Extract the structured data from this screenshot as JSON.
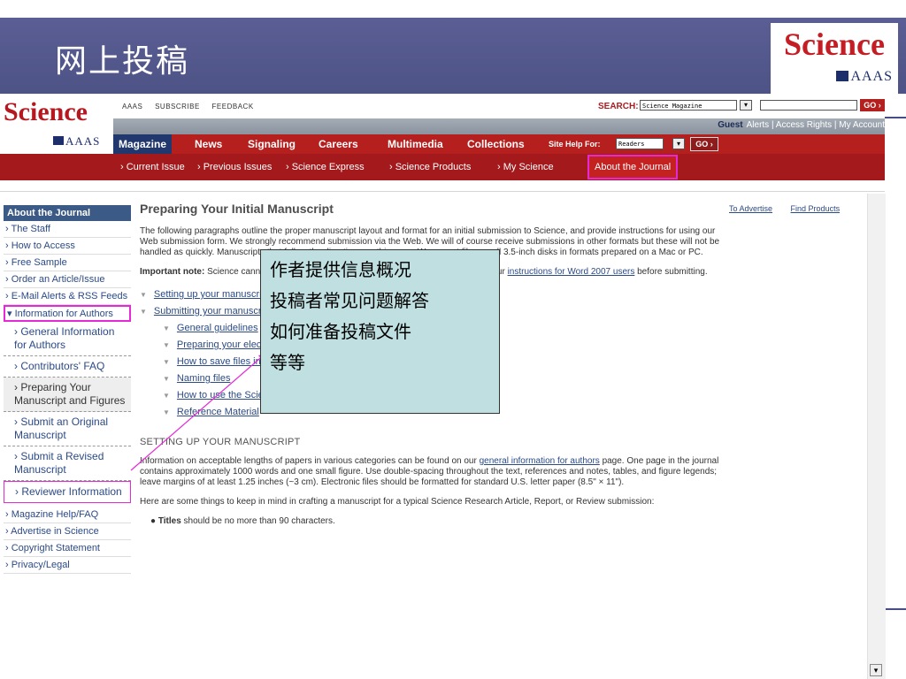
{
  "slide": {
    "title": "网上投稿",
    "logo_text": "Science",
    "logo_sub": "AAAS"
  },
  "site": {
    "logo": "Science",
    "logo_sub": "AAAS",
    "util_links": [
      "AAAS",
      "SUBSCRIBE",
      "FEEDBACK"
    ],
    "search_label": "SEARCH:",
    "search_select": "Science Magazine",
    "go": "GO ›",
    "guest": "Guest",
    "account_links": "Alerts | Access Rights | My Account",
    "nav_tabs": [
      "Magazine",
      "News",
      "Signaling",
      "Careers",
      "Multimedia",
      "Collections"
    ],
    "help_label": "Site Help For:",
    "help_select": "Readers",
    "help_go": "GO ›",
    "subnav": [
      "› Current Issue",
      "› Previous Issues",
      "› Science Express",
      "› Science Products",
      "› My Science",
      "About the Journal"
    ]
  },
  "leftnav": {
    "header": "About the Journal",
    "items": [
      "› The Staff",
      "› How to Access",
      "› Free Sample",
      "› Order an Article/Issue",
      "› E-Mail Alerts & RSS Feeds"
    ],
    "selected": "▾ Information for Authors",
    "sub_items": [
      "› General Information for Authors",
      "› Contributors' FAQ",
      "› Preparing Your Manuscript and Figures",
      "› Submit an Original Manuscript",
      "› Submit a Revised Manuscript",
      "› Reviewer Information"
    ],
    "bottom_items": [
      "› Magazine Help/FAQ",
      "› Advertise in Science",
      "› Copyright Statement",
      "› Privacy/Legal"
    ]
  },
  "toplinks": [
    "To Advertise",
    "Find Products"
  ],
  "article": {
    "title": "Preparing Your Initial Manuscript",
    "intro": "The following paragraphs outline the proper manuscript layout and format for an initial submission to Science, and provide instructions for using our Web submission form. We strongly recommend submission via the Web. We will of course receive submissions in other formats but these will not be handled as quickly. Manuscripts that follow the directions on this page. We accept files on all 3.5-inch disks in formats prepared on a Mac or PC.",
    "important_label": "Important note:",
    "important_text": "Science cannot accept files in the Word 2007 (.docx) format. Please see our",
    "important_link": "instructions for Word 2007 users",
    "important_tail": "before submitting.",
    "toc": [
      {
        "level": 1,
        "text": "Setting up your manuscript"
      },
      {
        "level": 1,
        "text": "Submitting your manuscript"
      },
      {
        "level": 2,
        "text": "General guidelines"
      },
      {
        "level": 2,
        "text": "Preparing your electronic files"
      },
      {
        "level": 2,
        "text": "How to save files in acceptable formats"
      },
      {
        "level": 2,
        "text": "Naming files"
      },
      {
        "level": 2,
        "text": "How to use the Science web form to submit a manuscript"
      },
      {
        "level": 2,
        "text": "Reference Material"
      }
    ],
    "section_heading": "SETTING UP YOUR MANUSCRIPT",
    "p1_start": "Information on acceptable lengths of papers in various categories can be found on our",
    "p1_link": "general information for authors",
    "p1_end": "page. One page in the journal contains approximately 1000 words and one small figure. Use double-spacing throughout the text, references and notes, tables, and figure legends; leave margins of at least 1.25 inches (~3 cm). Electronic files should be formatted for standard U.S. letter paper (8.5\" × 11\").",
    "p2": "Here are some things to keep in mind in crafting a manuscript for a typical Science Research Article, Report, or Review submission:",
    "bullet_bold": "Titles",
    "bullet_rest": "should be no more than 90 characters."
  },
  "overlay": {
    "lines": [
      "作者提供信息概况",
      "投稿者常见问题解答",
      "如何准备投稿文件",
      "等等"
    ]
  },
  "colors": {
    "slide_header": "#4e5386",
    "science_red": "#b51f1d",
    "magazine_blue": "#20386e",
    "highlight": "#e32ad6",
    "overlay_bg": "#bfdfe0"
  }
}
